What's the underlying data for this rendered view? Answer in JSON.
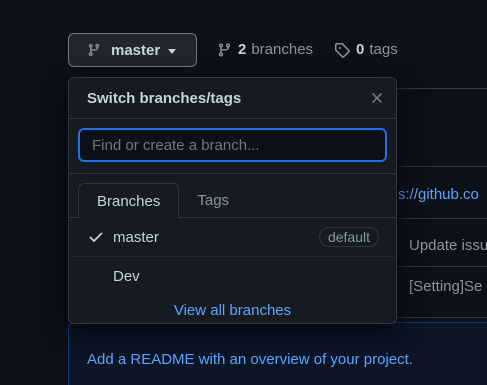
{
  "toolbar": {
    "branch_button_label": "master",
    "branches_count": "2",
    "branches_label": "branches",
    "tags_count": "0",
    "tags_label": "tags"
  },
  "dropdown": {
    "title": "Switch branches/tags",
    "filter_placeholder": "Find or create a branch...",
    "filter_value": "",
    "tabs": [
      {
        "label": "Branches",
        "active": true
      },
      {
        "label": "Tags",
        "active": false
      }
    ],
    "branches": [
      {
        "name": "master",
        "selected": true,
        "badge": "default"
      },
      {
        "name": "Dev",
        "selected": false,
        "badge": ""
      }
    ],
    "footer_link": "View all branches"
  },
  "background": {
    "url_fragment": "s://github.co",
    "commit_1": "Update issu",
    "commit_2": "[Setting]Se",
    "readme_prompt": "Add a README with an overview of your project."
  },
  "colors": {
    "accent": "#58a6ff",
    "focus_border": "#1f6feb",
    "background": "#0d1117",
    "panel": "#161b22"
  },
  "icons": {
    "branch": "git-branch-icon",
    "tag": "tag-icon",
    "close": "close-icon",
    "check": "check-icon",
    "caret": "caret-down-icon"
  }
}
